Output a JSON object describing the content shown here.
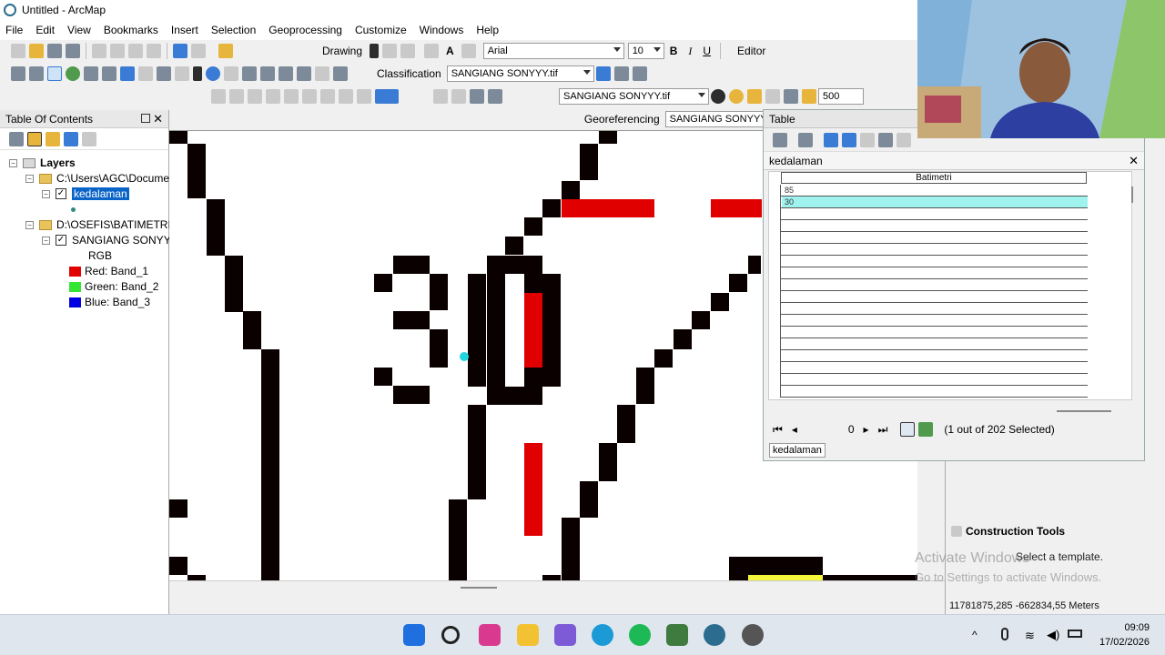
{
  "window": {
    "title": "Untitled - ArcMap"
  },
  "menu": [
    "File",
    "Edit",
    "View",
    "Bookmarks",
    "Insert",
    "Selection",
    "Geoprocessing",
    "Customize",
    "Windows",
    "Help"
  ],
  "toolbars": {
    "drawing_label": "Drawing",
    "font_name": "Arial",
    "font_size": "10",
    "bold": "B",
    "italic": "I",
    "underline": "U",
    "editor_label": "Editor",
    "classification_label": "Classification",
    "classification_layer": "SANGIANG SONYYY.tif",
    "effects_layer": "SANGIANG SONYYY.tif",
    "scale_value": "500",
    "georeferencing_label": "Georeferencing",
    "georef_layer": "SANGIANG SONYYY."
  },
  "toc": {
    "title": "Table Of Contents",
    "layers_label": "Layers",
    "group1": "C:\\Users\\AGC\\Documer",
    "layer1": "kedalaman",
    "group2": "D:\\OSEFIS\\BATIMETRI B/",
    "layer2": "SANGIANG SONYYY",
    "rgb_label": "RGB",
    "bands": [
      {
        "label": "Red:   Band_1",
        "color": "#e00000"
      },
      {
        "label": "Green: Band_2",
        "color": "#33e633"
      },
      {
        "label": "Blue:  Band_3",
        "color": "#0000e0"
      }
    ]
  },
  "table": {
    "window_title": "Table",
    "layer_title": "kedalaman",
    "column_header": "Batimetri",
    "rows": [
      "85",
      "30"
    ],
    "selected_row_index": 1,
    "current_record": "0",
    "selection_status": "(1 out of 202 Selected)",
    "tab_label": "kedalaman"
  },
  "right_panel": {
    "construction_tools": "Construction Tools",
    "template_hint": "Select a template.",
    "coordinates": "11781875,285  -662834,55 Meters"
  },
  "watermark": {
    "line1": "Activate Windows",
    "line2": "Go to Settings to activate Windows."
  },
  "taskbar": {
    "time": "09:09",
    "date": "17/02/2026"
  },
  "map": {
    "label_text": "30",
    "colors": {
      "black": "#0a0000",
      "red": "#e00000",
      "yellow": "#f5f53c",
      "cyan": "#22d6e0"
    }
  }
}
